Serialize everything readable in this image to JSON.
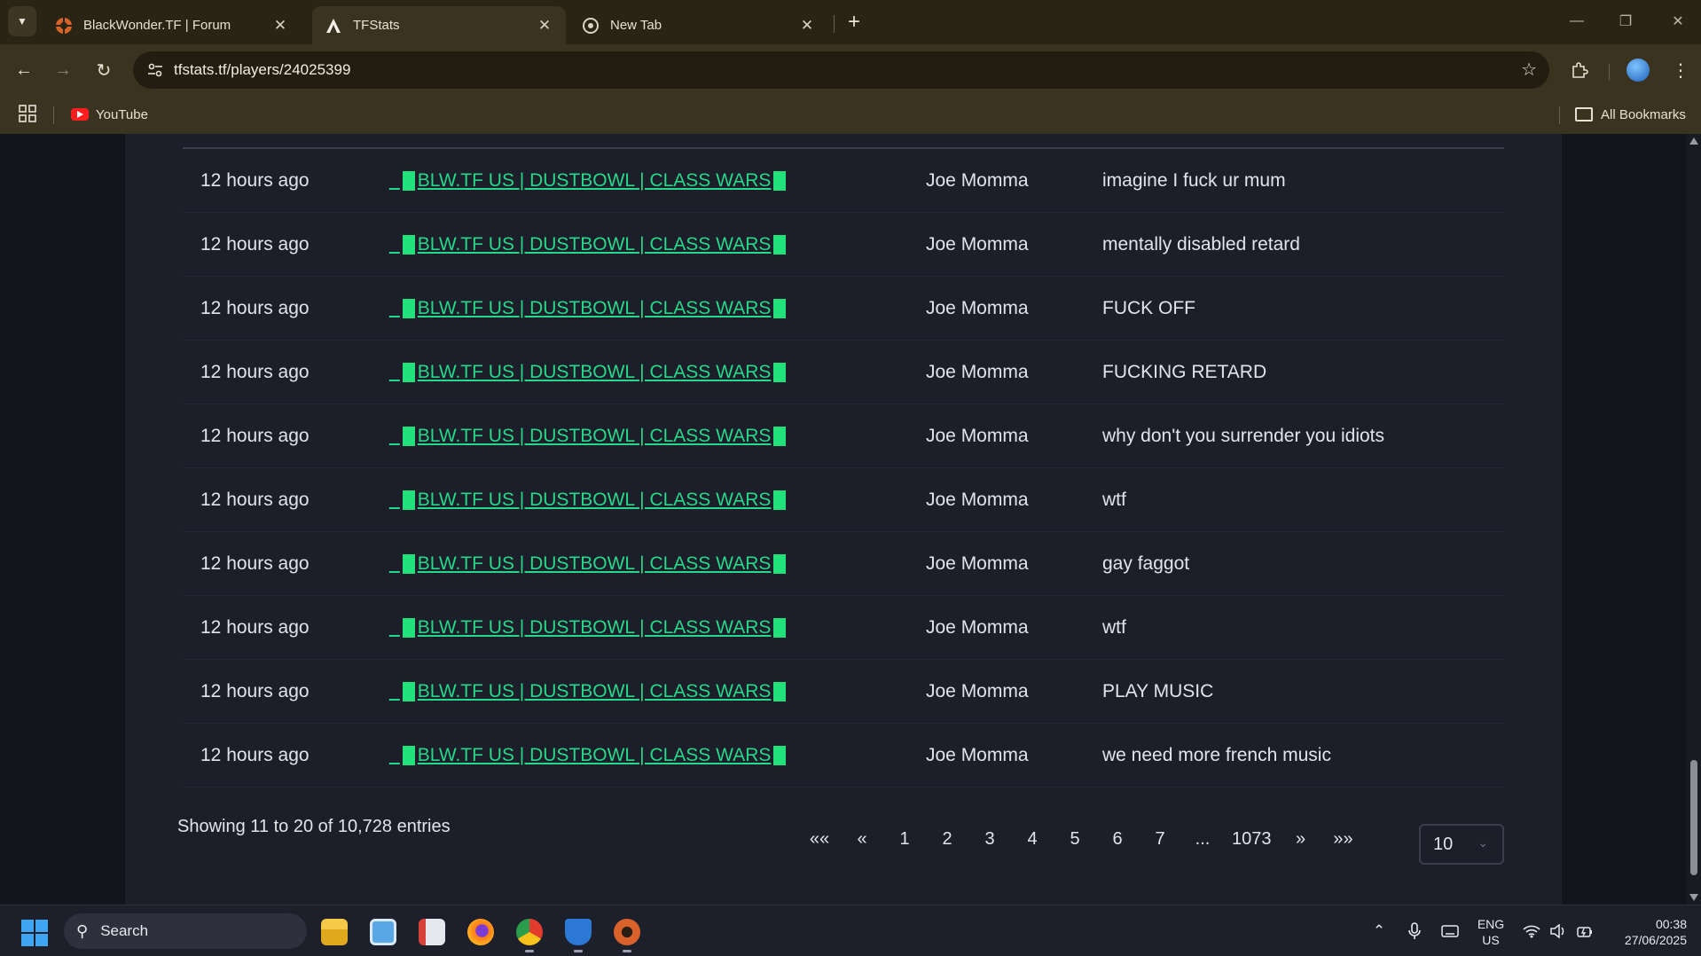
{
  "browser": {
    "tabs": [
      {
        "title": "BlackWonder.TF | Forum",
        "active": false
      },
      {
        "title": "TFStats",
        "active": true
      },
      {
        "title": "New Tab",
        "active": false
      }
    ],
    "url": "tfstats.tf/players/24025399",
    "bookmarks": [
      {
        "label": "YouTube",
        "icon": "youtube-icon"
      }
    ],
    "all_bookmarks_label": "All Bookmarks"
  },
  "table": {
    "rows": [
      {
        "time": "12 hours ago",
        "server": "BLW.TF US | DUSTBOWL | CLASS WARS",
        "player": "Joe Momma",
        "message": "imagine I fuck ur mum"
      },
      {
        "time": "12 hours ago",
        "server": "BLW.TF US | DUSTBOWL | CLASS WARS",
        "player": "Joe Momma",
        "message": "mentally disabled retard"
      },
      {
        "time": "12 hours ago",
        "server": "BLW.TF US | DUSTBOWL | CLASS WARS",
        "player": "Joe Momma",
        "message": "FUCK OFF"
      },
      {
        "time": "12 hours ago",
        "server": "BLW.TF US | DUSTBOWL | CLASS WARS",
        "player": "Joe Momma",
        "message": "FUCKING RETARD"
      },
      {
        "time": "12 hours ago",
        "server": "BLW.TF US | DUSTBOWL | CLASS WARS",
        "player": "Joe Momma",
        "message": "why don't you surrender you idiots"
      },
      {
        "time": "12 hours ago",
        "server": "BLW.TF US | DUSTBOWL | CLASS WARS",
        "player": "Joe Momma",
        "message": "wtf"
      },
      {
        "time": "12 hours ago",
        "server": "BLW.TF US | DUSTBOWL | CLASS WARS",
        "player": "Joe Momma",
        "message": "gay faggot"
      },
      {
        "time": "12 hours ago",
        "server": "BLW.TF US | DUSTBOWL | CLASS WARS",
        "player": "Joe Momma",
        "message": "wtf"
      },
      {
        "time": "12 hours ago",
        "server": "BLW.TF US | DUSTBOWL | CLASS WARS",
        "player": "Joe Momma",
        "message": "PLAY MUSIC"
      },
      {
        "time": "12 hours ago",
        "server": "BLW.TF US | DUSTBOWL | CLASS WARS",
        "player": "Joe Momma",
        "message": "we need more french music"
      }
    ],
    "server_prefix": "_",
    "entries_info": "Showing 11 to 20 of 10,728 entries"
  },
  "pagination": {
    "first": "««",
    "prev": "«",
    "pages": [
      "1",
      "2",
      "3",
      "4",
      "5",
      "6",
      "7",
      "...",
      "1073"
    ],
    "next": "»",
    "last": "»»",
    "page_size": "10"
  },
  "taskbar": {
    "search_label": "Search",
    "language": "ENG",
    "region": "US",
    "time": "00:38",
    "date": "27/06/2025"
  },
  "colors": {
    "accent_link": "#25d88a",
    "page_bg": "#14151c",
    "card_bg": "#1c1e29",
    "chrome_bg": "#3a3320"
  }
}
